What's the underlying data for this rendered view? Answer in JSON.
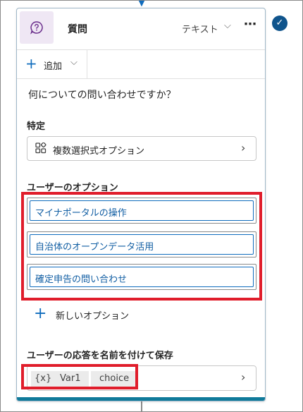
{
  "node": {
    "title": "質問",
    "type_label": "テキスト",
    "more_label": "⋯"
  },
  "toolbar": {
    "add_label": "追加"
  },
  "question": {
    "text": "何についての問い合わせですか？"
  },
  "identify": {
    "section_label": "特定",
    "value": "複数選択式オプション"
  },
  "options": {
    "section_label": "ユーザーのオプション",
    "items": [
      {
        "label": "マイナポータルの操作"
      },
      {
        "label": "自治体のオープンデータ活用"
      },
      {
        "label": "確定申告の問い合わせ"
      }
    ],
    "new_option_label": "新しいオプション"
  },
  "save": {
    "section_label": "ユーザーの応答を名前を付けて保存",
    "variable_icon": "{x}",
    "variable_name": "Var1",
    "variable_type": "choice"
  },
  "colors": {
    "accent": "#0f6cbd",
    "highlight": "#e01d2b",
    "card_bottom_bar": "#0f7a9a",
    "status_badge": "#0f548c",
    "icon_bg": "#efe7f4"
  },
  "icons": {
    "node": "question-bubble-icon",
    "identify": "multiple-choice-grid-icon",
    "status": "checkmark-circle-icon"
  }
}
